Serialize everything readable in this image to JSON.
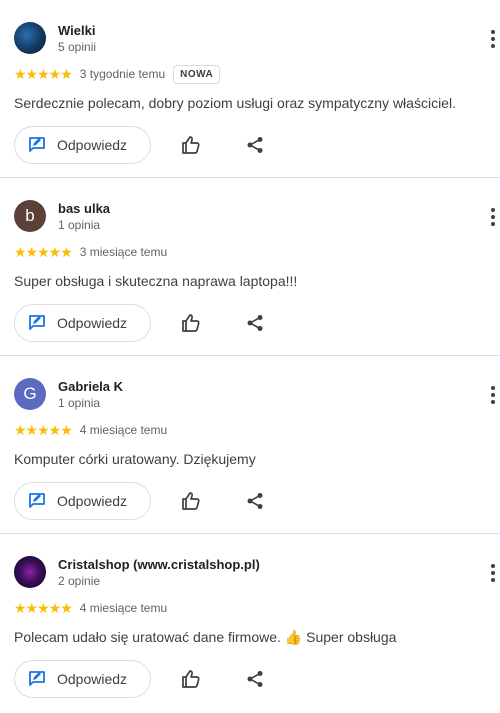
{
  "labels": {
    "reply": "Odpowiedz"
  },
  "reviews": [
    {
      "name": "Wielki",
      "count": "5 opinii",
      "stars": "★★★★★",
      "date": "3 tygodnie temu",
      "badge": "NOWA",
      "text": "Serdecznie polecam, dobry poziom usługi oraz sympatyczny właściciel.",
      "avatar_letter": ""
    },
    {
      "name": "bas ulka",
      "count": "1 opinia",
      "stars": "★★★★★",
      "date": "3 miesiące temu",
      "badge": "",
      "text": "Super obsługa i skuteczna naprawa laptopa!!!",
      "avatar_letter": "b"
    },
    {
      "name": "Gabriela K",
      "count": "1 opinia",
      "stars": "★★★★★",
      "date": "4 miesiące temu",
      "badge": "",
      "text": "Komputer córki uratowany. Dziękujemy",
      "avatar_letter": "G"
    },
    {
      "name": "Cristalshop (www.cristalshop.pl)",
      "count": "2 opinie",
      "stars": "★★★★★",
      "date": "4 miesiące temu",
      "badge": "",
      "text": "Polecam udało się uratować dane firmowe. 👍 Super obsługa",
      "avatar_letter": ""
    }
  ],
  "colors": {
    "star": "#fbbc04",
    "reply_icon": "#1a73e8",
    "divider": "#dadce0"
  },
  "icons": {
    "reply": "reply-edit-icon",
    "like": "thumb-up-icon",
    "share": "share-icon",
    "more": "more-vert-icon"
  }
}
